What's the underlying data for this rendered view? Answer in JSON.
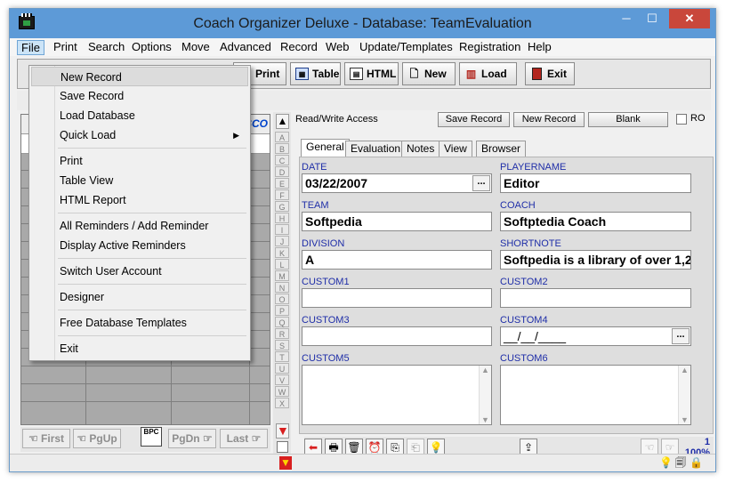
{
  "window": {
    "title": "Coach Organizer Deluxe - Database: TeamEvaluation",
    "controls": {
      "minimize": "─",
      "maximize": "☐",
      "close": "✕"
    }
  },
  "menubar": [
    "File",
    "Print",
    "Search",
    "Options",
    "Move",
    "Advanced",
    "Record",
    "Web",
    "Update/Templates",
    "Registration",
    "Help"
  ],
  "file_menu": [
    "New Record",
    "Save Record",
    "Load Database",
    "Quick Load",
    "Print",
    "Table View",
    "HTML Report",
    "All Reminders / Add Reminder",
    "Display Active Reminders",
    "Switch User Account",
    "Designer",
    "Free Database Templates",
    "Exit"
  ],
  "file_menu_submenu_arrow": "▶",
  "toolbar": {
    "print": "Print",
    "table": "Table",
    "html": "HTML",
    "new": "New",
    "load": "Load",
    "exit": "Exit"
  },
  "grid": {
    "header_fragment": "SCO"
  },
  "nav": {
    "first": "First",
    "pgup": "PgUp",
    "pgdn": "PgDn",
    "last": "Last",
    "bpc_icon_text": "BPC"
  },
  "letters": [
    "A",
    "B",
    "C",
    "D",
    "E",
    "F",
    "G",
    "H",
    "I",
    "J",
    "K",
    "L",
    "M",
    "N",
    "O",
    "P",
    "Q",
    "R",
    "S",
    "T",
    "U",
    "V",
    "W",
    "X"
  ],
  "record_header": {
    "access": "Read/Write Access",
    "save": "Save Record",
    "new": "New Record",
    "blank": "Blank",
    "ro": "RO"
  },
  "tabs": [
    "General",
    "Evaluation",
    "Notes",
    "View",
    "Browser"
  ],
  "fields": {
    "date": {
      "label": "DATE",
      "value": "03/22/2007",
      "button": "..."
    },
    "playername": {
      "label": "PLAYERNAME",
      "value": "Editor"
    },
    "team": {
      "label": "TEAM",
      "value": "Softpedia"
    },
    "coach": {
      "label": "COACH",
      "value": "Softptedia Coach"
    },
    "division": {
      "label": "DIVISION",
      "value": "A"
    },
    "shortnote": {
      "label": "SHORTNOTE",
      "value": "Softpedia is a library of over 1,20"
    },
    "custom1": {
      "label": "CUSTOM1",
      "value": ""
    },
    "custom2": {
      "label": "CUSTOM2",
      "value": ""
    },
    "custom3": {
      "label": "CUSTOM3",
      "value": ""
    },
    "custom4": {
      "label": "CUSTOM4",
      "value": "__/__/____",
      "button": "..."
    },
    "custom5": {
      "label": "CUSTOM5",
      "value": ""
    },
    "custom6": {
      "label": "CUSTOM6",
      "value": ""
    }
  },
  "page_info": {
    "record": "1",
    "zoom": "100%"
  },
  "scroll_arrows": {
    "up": "▲",
    "down": "▼"
  },
  "colors": {
    "titlebar": "#5d9ad7",
    "label": "#1f2ea8",
    "close": "#c9473b"
  }
}
